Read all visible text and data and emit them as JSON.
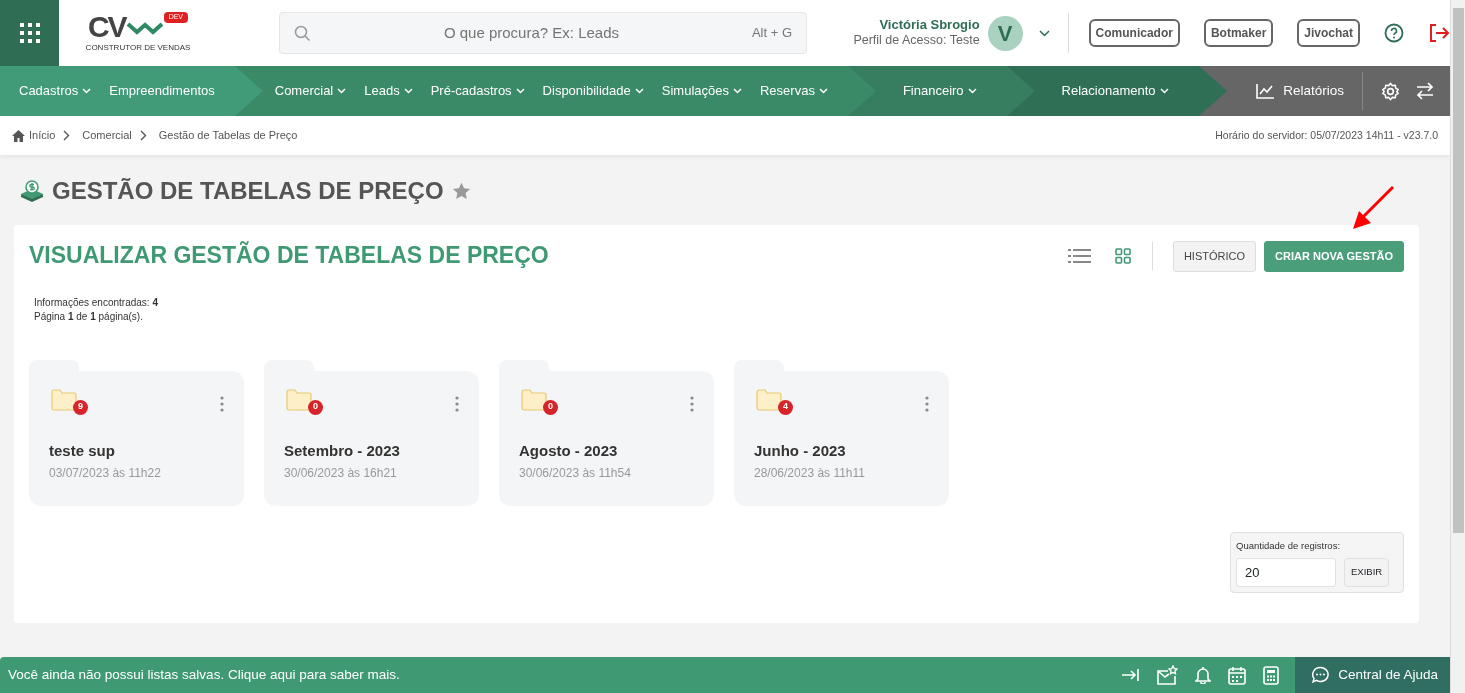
{
  "header": {
    "logo": {
      "letters": "CV",
      "tag": "DEV",
      "subtitle": "CONSTRUTOR DE VENDAS"
    },
    "search": {
      "placeholder": "O que procura? Ex: Leads",
      "shortcut": "Alt + G"
    },
    "user": {
      "name": "Victória Sbrogio",
      "profile": "Perfil de Acesso: Teste",
      "initial": "V"
    },
    "buttons": [
      "Comunicador",
      "Botmaker",
      "Jivochat"
    ]
  },
  "nav": {
    "groups": [
      {
        "color": "#419b78",
        "items": [
          {
            "label": "Cadastros",
            "dropdown": true
          },
          {
            "label": "Empreendimentos",
            "dropdown": false
          }
        ]
      },
      {
        "color": "#3a8a68",
        "items": [
          {
            "label": "Comercial",
            "dropdown": true
          },
          {
            "label": "Leads",
            "dropdown": true
          },
          {
            "label": "Pré-cadastros",
            "dropdown": true
          },
          {
            "label": "Disponibilidade",
            "dropdown": true
          },
          {
            "label": "Simulações",
            "dropdown": true
          },
          {
            "label": "Reservas",
            "dropdown": true
          }
        ]
      },
      {
        "color": "#367e5f",
        "items": [
          {
            "label": "Financeiro",
            "dropdown": true
          }
        ]
      },
      {
        "color": "#2e6f55",
        "items": [
          {
            "label": "Relacionamento",
            "dropdown": true
          }
        ]
      }
    ],
    "reports": "Relatórios"
  },
  "breadcrumb": [
    "Início",
    "Comercial",
    "Gestão de Tabelas de Preço"
  ],
  "server_time": "Horário do servidor: 05/07/2023 14h11 - v23.7.0",
  "page_title": "GESTÃO DE TABELAS DE PREÇO",
  "panel": {
    "title": "VISUALIZAR GESTÃO DE TABELAS DE PREÇO",
    "views": [
      {
        "kind": "list",
        "selected": false
      },
      {
        "kind": "grid",
        "selected": true
      }
    ],
    "buttons": [
      {
        "label": "HISTÓRICO",
        "kind": "secondary"
      },
      {
        "label": "CRIAR NOVA GESTÃO",
        "kind": "primary"
      }
    ],
    "info": [
      "Informações encontradas: **4**",
      "Página **1** de **1** página(s)."
    ],
    "folders": [
      {
        "name": "teste sup",
        "date": "03/07/2023 às 11h22",
        "count": "9"
      },
      {
        "name": "Setembro - 2023",
        "date": "30/06/2023 às 16h21",
        "count": "0"
      },
      {
        "name": "Agosto - 2023",
        "date": "30/06/2023 às 11h54",
        "count": "0"
      },
      {
        "name": "Junho - 2023",
        "date": "28/06/2023 às 11h11",
        "count": "4"
      }
    ],
    "records": {
      "label": "Quantidade de registros:",
      "value": "20",
      "button": "EXIBIR"
    }
  },
  "footer": {
    "message": "Você ainda não possui listas salvas. Clique aqui para saber mais.",
    "help": "Central de Ajuda"
  }
}
